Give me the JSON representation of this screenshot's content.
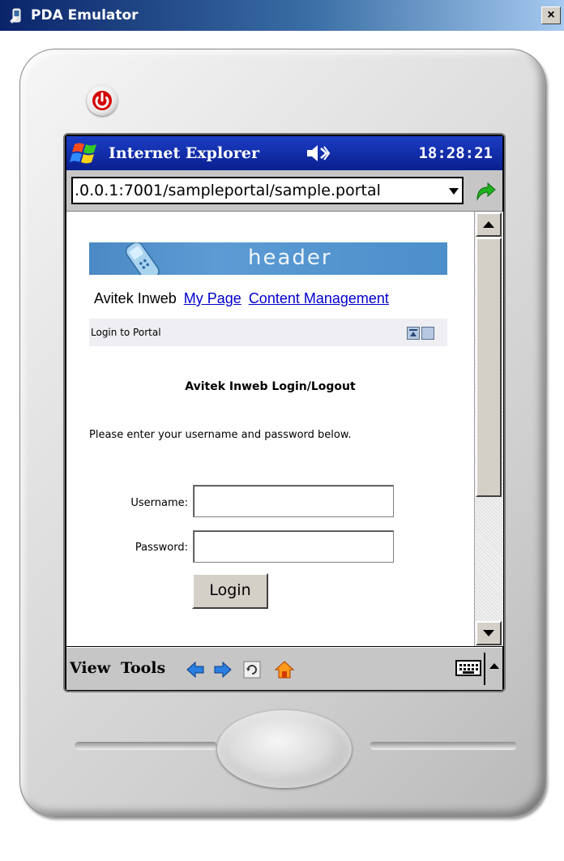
{
  "window": {
    "title": "PDA Emulator",
    "close_label": "×"
  },
  "device": {
    "status_bar": {
      "app_title": "Internet Explorer",
      "clock": "18:28:21"
    },
    "address_bar": {
      "url": ".0.0.1:7001/sampleportal/sample.portal"
    },
    "page": {
      "banner_text": "header",
      "nav": {
        "brand": "Avitek Inweb",
        "links": [
          "My Page",
          "Content Management"
        ]
      },
      "portlet": {
        "title": "Login to Portal"
      },
      "login": {
        "heading": "Avitek Inweb Login/Logout",
        "instructions": "Please enter your username and password below.",
        "username_label": "Username:",
        "password_label": "Password:",
        "username_value": "",
        "password_value": "",
        "submit_label": "Login"
      }
    },
    "menu_bar": {
      "view": "View",
      "tools": "Tools"
    }
  },
  "colors": {
    "titlebar_start": "#0a246a",
    "status_bar": "#0a28a8",
    "banner": "#4a89c4",
    "link": "#0000cc",
    "power_red": "#d40000"
  }
}
